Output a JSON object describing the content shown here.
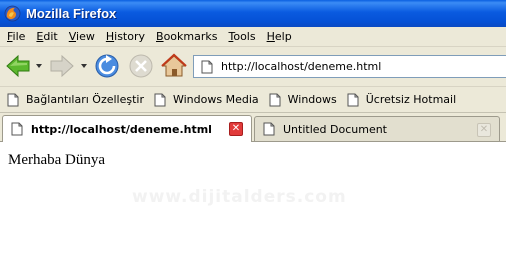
{
  "window": {
    "title": "Mozilla Firefox"
  },
  "menu": {
    "items": [
      "File",
      "Edit",
      "View",
      "History",
      "Bookmarks",
      "Tools",
      "Help"
    ]
  },
  "navigation": {
    "back_icon": "back-arrow-icon",
    "forward_icon": "forward-arrow-icon",
    "reload_icon": "reload-icon",
    "stop_icon": "stop-icon",
    "home_icon": "home-icon",
    "url": "http://localhost/deneme.html"
  },
  "bookmarks": {
    "items": [
      "Bağlantıları Özelleştir",
      "Windows Media",
      "Windows",
      "Ücretsiz Hotmail"
    ]
  },
  "tabs": [
    {
      "label": "http://localhost/deneme.html",
      "active": true
    },
    {
      "label": "Untitled Document",
      "active": false
    }
  ],
  "page": {
    "text": "Merhaba Dünya",
    "watermark": "www.dijitalders.com"
  },
  "colors": {
    "titlebar": "#0a5be0",
    "chrome": "#ece9d8",
    "close_active": "#e13a3a"
  }
}
